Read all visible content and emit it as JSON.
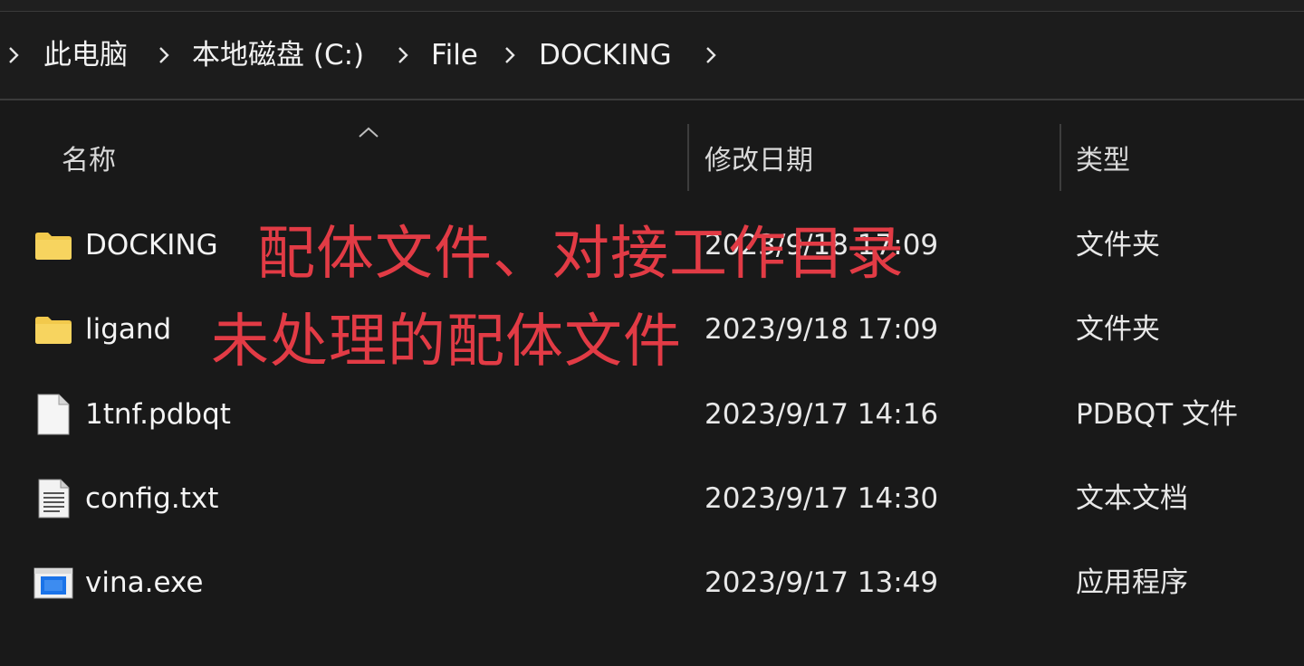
{
  "breadcrumb": {
    "items": [
      "此电脑",
      "本地磁盘 (C:)",
      "File",
      "DOCKING"
    ]
  },
  "columns": {
    "name": "名称",
    "modified": "修改日期",
    "type": "类型"
  },
  "files": [
    {
      "icon": "folder-icon",
      "name": "DOCKING",
      "modified": "2023/9/18 17:09",
      "type": "文件夹"
    },
    {
      "icon": "folder-icon",
      "name": "ligand",
      "modified": "2023/9/18 17:09",
      "type": "文件夹"
    },
    {
      "icon": "blank-file-icon",
      "name": "1tnf.pdbqt",
      "modified": "2023/9/17 14:16",
      "type": "PDBQT 文件"
    },
    {
      "icon": "text-file-icon",
      "name": "config.txt",
      "modified": "2023/9/17 14:30",
      "type": "文本文档"
    },
    {
      "icon": "executable-icon",
      "name": "vina.exe",
      "modified": "2023/9/17 13:49",
      "type": "应用程序"
    }
  ],
  "annotations": [
    "配体文件、对接工作目录",
    "未处理的配体文件"
  ],
  "colors": {
    "background": "#191919",
    "annotation": "#e23b45",
    "folder": "#f2c94c"
  }
}
